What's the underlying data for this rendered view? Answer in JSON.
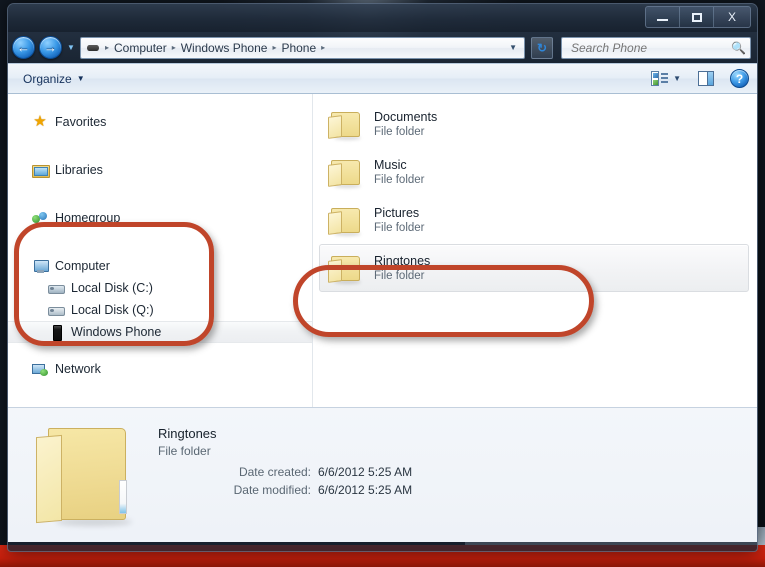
{
  "window": {
    "titlebar": {
      "minimize_label": "Minimize",
      "maximize_label": "Maximize",
      "close_label": "X"
    }
  },
  "nav": {
    "back_label": "←",
    "forward_label": "→",
    "recent_caret": "▼",
    "address": {
      "device_icon": "device-icon",
      "crumbs": [
        "Computer",
        "Windows Phone",
        "Phone"
      ],
      "separator": "▸",
      "dropdown_caret": "▼"
    },
    "refresh_label": "↻",
    "search": {
      "placeholder": "Search Phone",
      "value": "",
      "icon": "search-icon"
    }
  },
  "toolbar": {
    "organize_label": "Organize",
    "organize_caret": "▼",
    "view_caret": "▼",
    "help_label": "?"
  },
  "sidebar": {
    "items": [
      {
        "label": "Favorites",
        "icon": "star-icon",
        "level": "root",
        "selected": false
      },
      {
        "label": "Libraries",
        "icon": "library-icon",
        "level": "root",
        "selected": false
      },
      {
        "label": "Homegroup",
        "icon": "homegroup-icon",
        "level": "root",
        "selected": false
      },
      {
        "label": "Computer",
        "icon": "computer-icon",
        "level": "root",
        "selected": false
      },
      {
        "label": "Local Disk (C:)",
        "icon": "hdd-icon",
        "level": "child",
        "selected": false
      },
      {
        "label": "Local Disk (Q:)",
        "icon": "hdd-icon",
        "level": "child",
        "selected": false
      },
      {
        "label": "Windows Phone",
        "icon": "phone-icon",
        "level": "child",
        "selected": true
      },
      {
        "label": "Network",
        "icon": "network-icon",
        "level": "root",
        "selected": false
      }
    ]
  },
  "filelist": {
    "items": [
      {
        "name": "Documents",
        "type": "File folder",
        "selected": false
      },
      {
        "name": "Music",
        "type": "File folder",
        "selected": false
      },
      {
        "name": "Pictures",
        "type": "File folder",
        "selected": false
      },
      {
        "name": "Ringtones",
        "type": "File folder",
        "selected": true
      }
    ]
  },
  "details": {
    "title": "Ringtones",
    "subtitle": "File folder",
    "rows": [
      {
        "label": "Date created:",
        "value": "6/6/2012 5:25 AM"
      },
      {
        "label": "Date modified:",
        "value": "6/6/2012 5:25 AM"
      }
    ]
  },
  "annotations": {
    "color": "#c0452a",
    "shapes": [
      "sidebar-computer-group",
      "ringtones-row"
    ]
  }
}
